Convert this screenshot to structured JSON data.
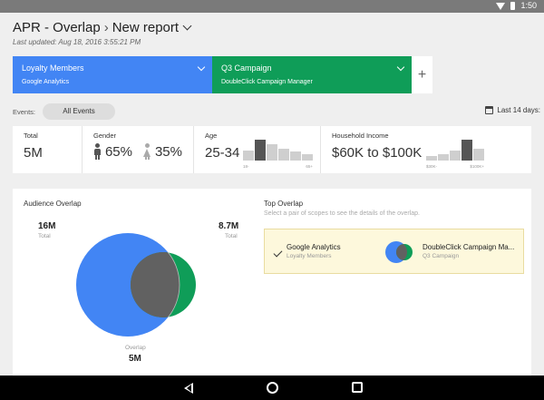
{
  "statusbar": {
    "time": "1:50"
  },
  "header": {
    "breadcrumb_root": "APR - Overlap",
    "breadcrumb_sep": "›",
    "report_name": "New report",
    "last_updated": "Last updated: Aug 18, 2016 3:55:21 PM"
  },
  "scopes": [
    {
      "name": "Loyalty Members",
      "source": "Google Analytics",
      "color": "#4285f4"
    },
    {
      "name": "Q3 Campaign",
      "source": "DoubleClick Campaign Manager",
      "color": "#0f9d58"
    }
  ],
  "add_scope_label": "+",
  "events": {
    "label": "Events:",
    "chip": "All Events"
  },
  "date_range": "Last 14 days:",
  "metrics": {
    "total": {
      "label": "Total",
      "value": "5M"
    },
    "gender": {
      "label": "Gender",
      "male": "65%",
      "female": "35%"
    },
    "age": {
      "label": "Age",
      "value": "25-34",
      "tick_min": "18-",
      "tick_max": "65+",
      "bars": [
        0.45,
        0.95,
        0.75,
        0.55,
        0.4,
        0.3
      ],
      "highlight": 1
    },
    "income": {
      "label": "Household Income",
      "value": "$60K to $100K",
      "tick_min": "$30K-",
      "tick_max": "$100K+",
      "bars": [
        0.2,
        0.3,
        0.45,
        0.95,
        0.55
      ],
      "highlight": 3
    }
  },
  "overlap": {
    "title": "Audience Overlap",
    "left_total": "16M",
    "right_total": "8.7M",
    "total_label": "Total",
    "overlap_label": "Overlap",
    "overlap_value": "5M",
    "colors": {
      "left": "#4285f4",
      "right": "#0f9d58",
      "overlap": "#616161"
    }
  },
  "top_overlap": {
    "title": "Top Overlap",
    "subtitle": "Select a pair of scopes to see the details of the overlap.",
    "pair": {
      "scope1_name": "Google Analytics",
      "scope1_sub": "Loyalty Members",
      "scope2_name": "DoubleClick Campaign Ma...",
      "scope2_sub": "Q3 Campaign"
    }
  },
  "icons": {
    "statusbar": [
      "wifi-icon",
      "battery-icon"
    ],
    "dropdown": "chevron-down-icon",
    "calendar": "calendar-icon",
    "gender": [
      "male-icon",
      "female-icon"
    ],
    "check": "check-icon",
    "nav": [
      "back-icon",
      "home-icon",
      "recents-icon"
    ]
  }
}
